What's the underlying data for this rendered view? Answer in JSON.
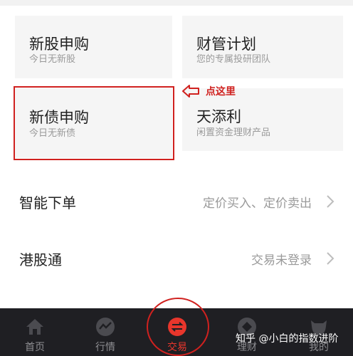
{
  "cards": [
    {
      "title": "新股申购",
      "subtitle": "今日无新股"
    },
    {
      "title": "财管计划",
      "subtitle": "您的专属投研团队"
    },
    {
      "title": "新债申购",
      "subtitle": "今日无新债"
    },
    {
      "title": "天添利",
      "subtitle": "闲置资金理财产品"
    }
  ],
  "annotation": {
    "text": "点这里",
    "color": "#d0211f"
  },
  "rows": [
    {
      "title": "智能下单",
      "value": "定价买入、定价卖出"
    },
    {
      "title": "港股通",
      "value": "交易未登录"
    }
  ],
  "tabbar": {
    "items": [
      {
        "label": "首页",
        "icon": "home-icon"
      },
      {
        "label": "行情",
        "icon": "market-chart-icon"
      },
      {
        "label": "交易",
        "icon": "trade-exchange-icon",
        "active": true
      },
      {
        "label": "理财",
        "icon": "wealth-diamond-icon"
      },
      {
        "label": "我的",
        "icon": "profile-bull-icon"
      }
    ],
    "active_color": "#e8362c"
  },
  "watermark": "知乎 @小白的指数进阶"
}
